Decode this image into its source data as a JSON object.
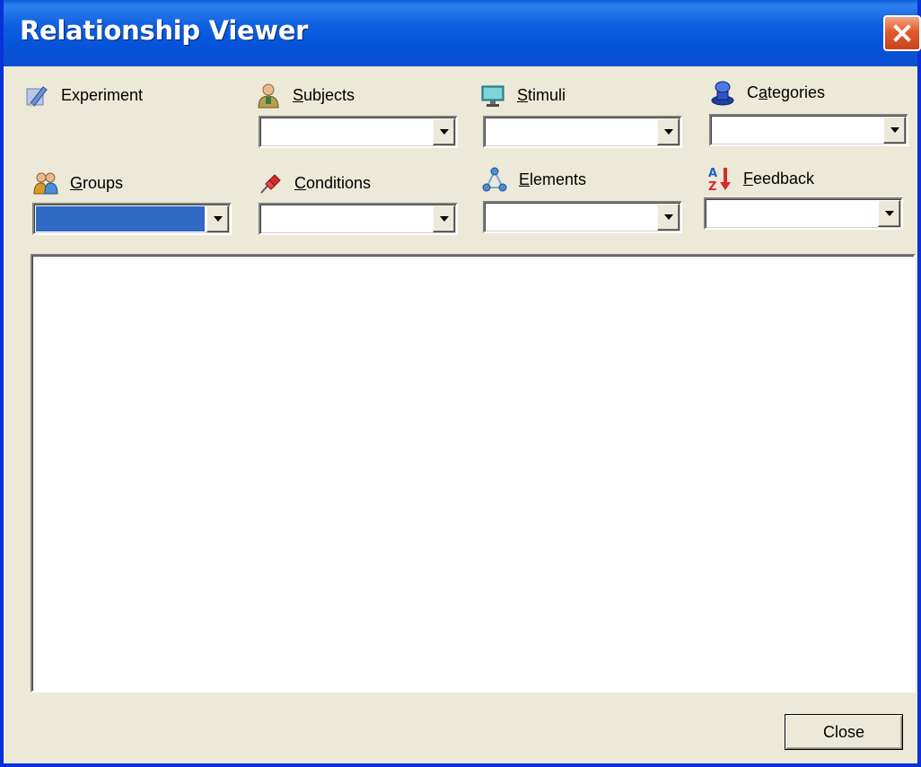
{
  "window": {
    "title": "Relationship Viewer"
  },
  "fields": {
    "experiment": {
      "label": "Experiment",
      "icon": "experiment-pencil-icon"
    },
    "subjects": {
      "label_access": "S",
      "label_rest": "ubjects",
      "value": "",
      "icon": "subjects-person-icon"
    },
    "stimuli": {
      "label_access": "S",
      "label_rest": "timuli",
      "value": "",
      "icon": "stimuli-monitor-icon"
    },
    "categories": {
      "label_pre": "C",
      "label_access": "a",
      "label_rest": "tegories",
      "value": "",
      "icon": "categories-stamp-icon"
    },
    "groups": {
      "label_access": "G",
      "label_rest": "roups",
      "value": "",
      "icon": "groups-people-icon"
    },
    "conditions": {
      "label_access": "C",
      "label_rest": "onditions",
      "value": "",
      "icon": "conditions-pin-icon"
    },
    "elements": {
      "label_access": "E",
      "label_rest": "lements",
      "value": "",
      "icon": "elements-network-icon"
    },
    "feedback": {
      "label_access": "F",
      "label_rest": "eedback",
      "value": "",
      "icon": "feedback-sort-az-icon"
    }
  },
  "buttons": {
    "close_label": "Close"
  },
  "colors": {
    "titlebar": "#0553d8",
    "selection": "#316ac5",
    "window_bg": "#ece9d8",
    "close_x": "#e35a2d"
  }
}
